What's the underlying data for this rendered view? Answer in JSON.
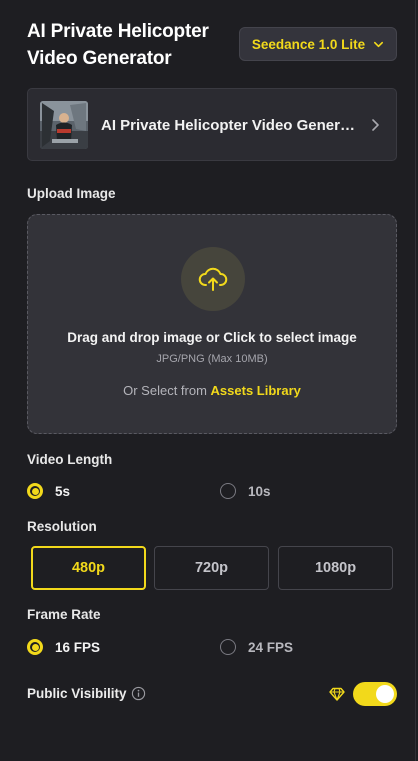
{
  "header": {
    "title": "AI Private Helicopter Video Generator",
    "model_select": {
      "value": "Seedance 1.0 Lite",
      "icon": "chevron-down-icon"
    }
  },
  "template": {
    "name": "AI Private Helicopter Video Generator",
    "thumbnail": "helicopter-scene-thumbnail",
    "icon": "chevron-right-icon"
  },
  "upload": {
    "label": "Upload Image",
    "icon": "cloud-upload-icon",
    "main_text": "Drag and drop image or Click to select image",
    "sub_text": "JPG/PNG (Max 10MB)",
    "assets_prefix": "Or Select from ",
    "assets_link": "Assets Library"
  },
  "video_length": {
    "label": "Video Length",
    "options": [
      {
        "label": "5s",
        "selected": true
      },
      {
        "label": "10s",
        "selected": false
      }
    ]
  },
  "resolution": {
    "label": "Resolution",
    "options": [
      {
        "label": "480p",
        "selected": true
      },
      {
        "label": "720p",
        "selected": false
      },
      {
        "label": "1080p",
        "selected": false
      }
    ]
  },
  "frame_rate": {
    "label": "Frame Rate",
    "options": [
      {
        "label": "16 FPS",
        "selected": true
      },
      {
        "label": "24 FPS",
        "selected": false
      }
    ]
  },
  "visibility": {
    "label": "Public Visibility",
    "info_icon": "info-icon",
    "premium_icon": "diamond-icon",
    "enabled": true
  },
  "colors": {
    "accent": "#f2d91b",
    "background": "#1e1e22",
    "card": "#2b2b31",
    "upload_area": "#333339"
  }
}
